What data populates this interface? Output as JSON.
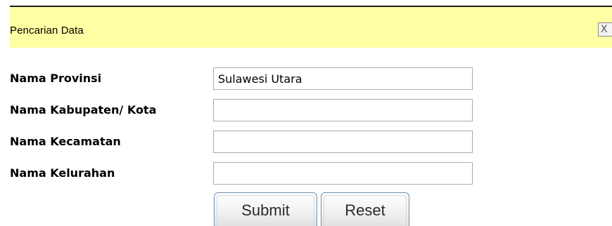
{
  "dialog": {
    "title": "Pencarian Data",
    "close_label": "X"
  },
  "form": {
    "provinsi": {
      "label": "Nama Provinsi",
      "value": "Sulawesi Utara"
    },
    "kabupaten": {
      "label": "Nama Kabupaten/ Kota",
      "value": ""
    },
    "kecamatan": {
      "label": "Nama Kecamatan",
      "value": ""
    },
    "kelurahan": {
      "label": "Nama Kelurahan",
      "value": ""
    }
  },
  "buttons": {
    "submit_label": "Submit",
    "reset_label": "Reset"
  },
  "colors": {
    "header_background": "#ffffa3",
    "button_border": "#6d8fb0"
  },
  "icons": {
    "close": "close-icon"
  }
}
